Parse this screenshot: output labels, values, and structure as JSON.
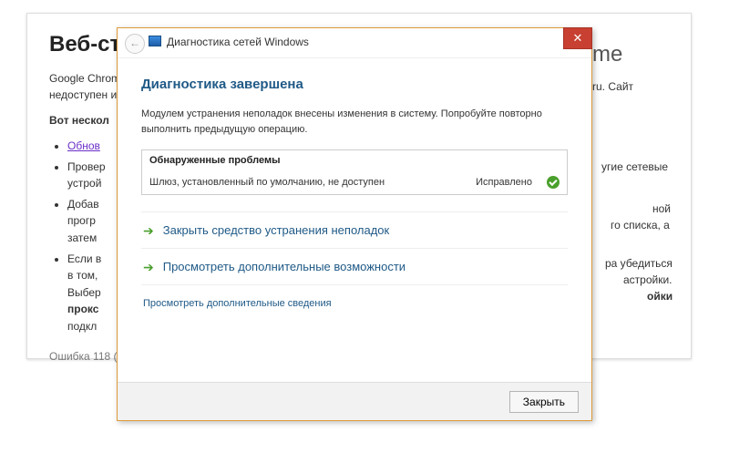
{
  "page": {
    "title_visible": "Веб-стр",
    "title_suffix": "me",
    "para1": "Google Chrom",
    "para2": "недоступен и",
    "para1_tail": "ru. Сайт",
    "list_header": "Вот нескол",
    "li1": "Обнов",
    "li2a": "Провер",
    "li2b": "устрой",
    "li2_tail": "угие сетевые",
    "li3a": "Добав",
    "li3b": "прогр",
    "li3c": "затем",
    "li3_tail1": "ной",
    "li3_tail2": "го списка, а",
    "li4a": "Если в",
    "li4b": "в том,",
    "li4c": "Выбер",
    "li4d": "прокс",
    "li4e": "подкл",
    "li4_tail1": "ра убедиться",
    "li4_tail2": "астройки.",
    "li4_tail3": "ойки",
    "error": "Ошибка 118 ("
  },
  "wizard": {
    "title": "Диагностика сетей Windows",
    "complete": "Диагностика завершена",
    "description": "Модулем устранения неполадок внесены изменения в систему. Попробуйте повторно выполнить предыдущую операцию.",
    "issues_header": "Обнаруженные проблемы",
    "issue_text": "Шлюз, установленный по умолчанию, не доступен",
    "issue_status": "Исправлено",
    "action_close_troubleshooter": "Закрыть средство устранения неполадок",
    "action_more_options": "Просмотреть дополнительные возможности",
    "details_link": "Просмотреть дополнительные сведения",
    "close_button": "Закрыть",
    "close_x": "✕"
  }
}
